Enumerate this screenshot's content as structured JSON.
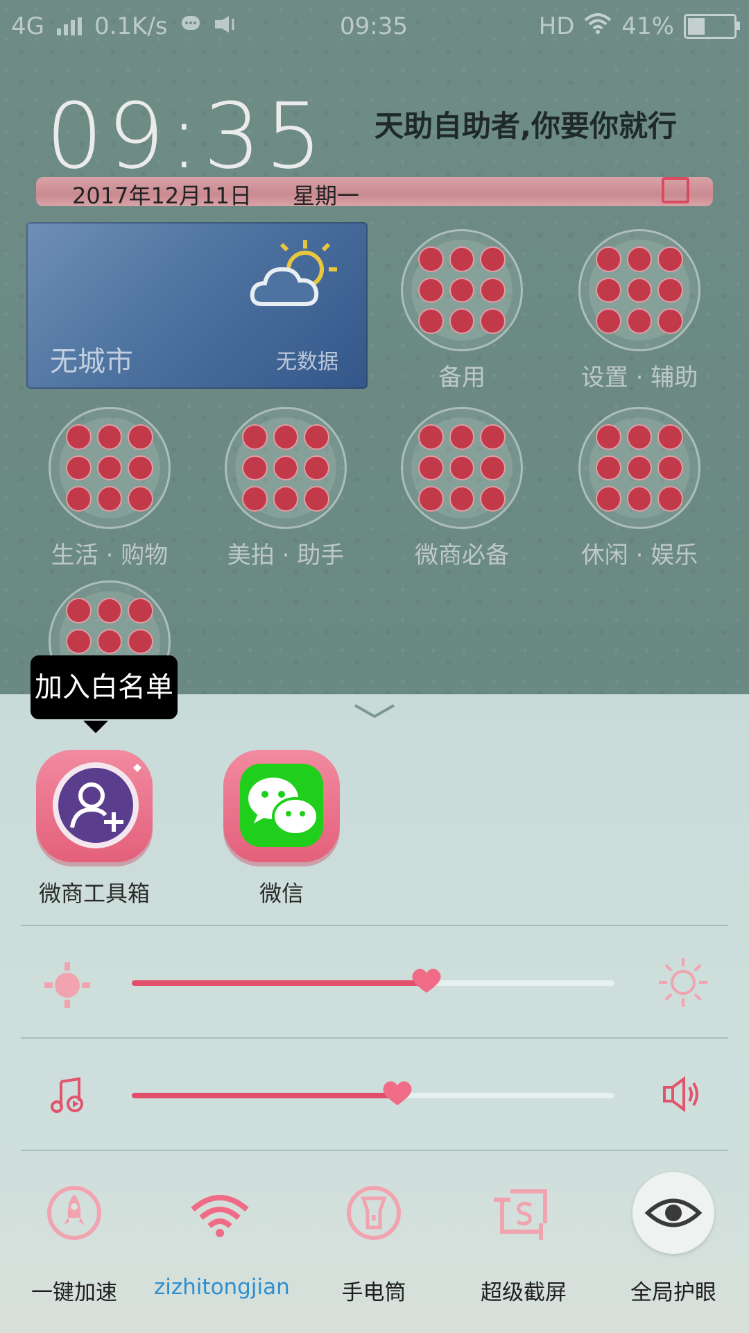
{
  "status_bar": {
    "network": "4G",
    "speed": "0.1K/s",
    "time": "09:35",
    "hd": "HD",
    "battery": "41%",
    "battery_level": 0.41
  },
  "clock_widget": {
    "time": "09:35",
    "slogan": "天助自助者,你要你就行",
    "date": "2017年12月11日",
    "weekday": "星期一"
  },
  "weather_widget": {
    "city": "无城市",
    "status": "无数据"
  },
  "folders": [
    {
      "label": "备用"
    },
    {
      "label": "设置 · 辅助"
    },
    {
      "label": "生活 · 购物"
    },
    {
      "label": "美拍 · 助手"
    },
    {
      "label": "微商必备"
    },
    {
      "label": "休闲 · 娱乐"
    },
    {
      "label": ""
    }
  ],
  "panel": {
    "tooltip": "加入白名单",
    "apps": [
      {
        "label": "微商工具箱",
        "icon": "add-user-icon"
      },
      {
        "label": "微信",
        "icon": "wechat-icon"
      }
    ],
    "brightness_level": 0.61,
    "volume_level": 0.55,
    "toggles": [
      {
        "label": "一键加速",
        "icon": "rocket-icon",
        "active": false
      },
      {
        "label": "zizhitongjian",
        "icon": "wifi-icon",
        "active": true
      },
      {
        "label": "手电筒",
        "icon": "flashlight-icon",
        "active": false
      },
      {
        "label": "超级截屏",
        "icon": "screenshot-icon",
        "active": false
      },
      {
        "label": "全局护眼",
        "icon": "eye-icon",
        "active": false
      }
    ]
  },
  "colors": {
    "accent": "#e24f6a",
    "active_label": "#2b8fd1"
  }
}
